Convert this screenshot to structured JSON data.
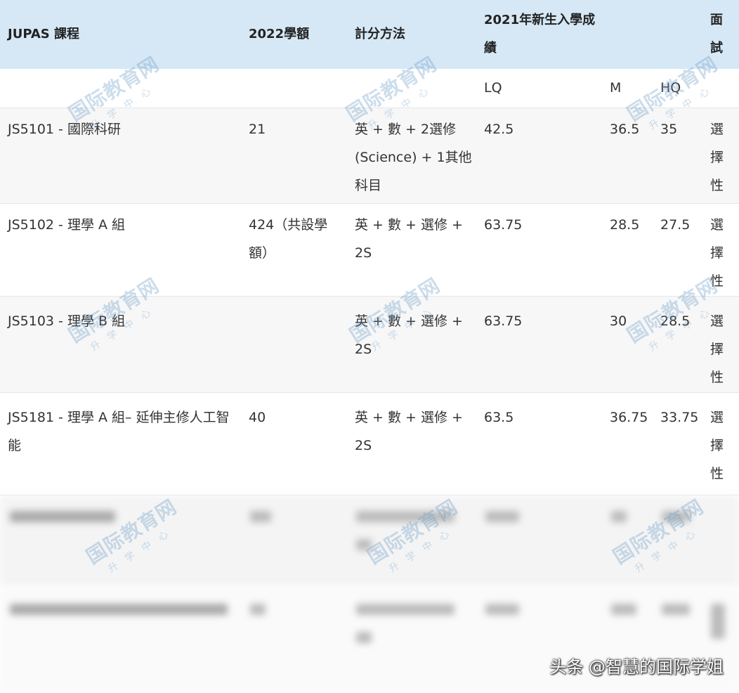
{
  "header": {
    "course": "JUPAS 課程",
    "quota": "2022學額",
    "method": "計分方法",
    "scores": "2021年新生入學成績",
    "interview": "面試"
  },
  "subheader": {
    "lq": "LQ",
    "m": "M",
    "hq": "HQ"
  },
  "rows": [
    {
      "course": "JS5101 - 國際科研",
      "quota": "21",
      "method": "英 + 數 + 2選修 (Science) + 1其他科目",
      "lq": "42.5",
      "m": "36.5",
      "hq": "35",
      "interview": "選擇性"
    },
    {
      "course": "JS5102 - 理學 A 組",
      "quota": "424（共設學額）",
      "method": "英 + 數 + 選修 + 2S",
      "lq": "63.75",
      "m": "28.5",
      "hq": "27.5",
      "interview": "選擇性"
    },
    {
      "course": "JS5103 - 理學 B 組",
      "quota": "",
      "method": "英 + 數 + 選修 + 2S",
      "lq": "63.75",
      "m": "30",
      "hq": "28.5",
      "interview": "選擇性"
    },
    {
      "course": "JS5181 - 理學 A 組– 延伸主修人工智能",
      "quota": "40",
      "method": "英 + 數 + 選修 + 2S",
      "lq": "63.5",
      "m": "36.75",
      "hq": "33.75",
      "interview": "選擇性"
    }
  ],
  "watermark": {
    "title": "国际教育网",
    "sub": "升学中心"
  },
  "credit": "头条 @智慧的国际学姐"
}
